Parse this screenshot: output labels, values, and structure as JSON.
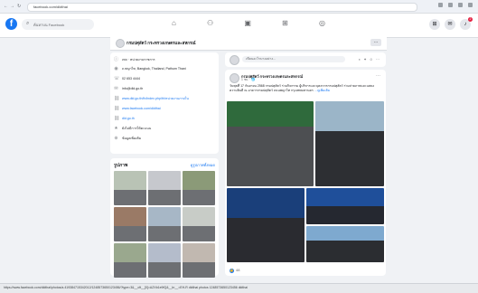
{
  "browser": {
    "url": "facebook.com/dldthai",
    "status_url": "https://www.facebook.com/dldthai/photos/a.419384715342012/1248573650123456/?type=3&__cft__[0]=AZXb1e9fQ&__tn__=EH-R dldthai photos 1248573650123456 dldthai"
  },
  "header": {
    "logo": "f",
    "search_placeholder": "ค้นหาบน Facebook",
    "notif_count": "2"
  },
  "page": {
    "name": "กรมปศุสัตว์ กระทรวงเกษตรและสหกรณ์",
    "more": "…"
  },
  "intro": {
    "items": [
      {
        "icon": "info-icon",
        "glyph": "ⓘ",
        "text": "เพจ · หน่วยงานราชการ"
      },
      {
        "icon": "location-icon",
        "glyph": "◉",
        "text": "ถ.พญาไท, Bangkok, Thailand, Pathum Thani"
      },
      {
        "icon": "phone-icon",
        "glyph": "☏",
        "text": "02 653 4444"
      },
      {
        "icon": "email-icon",
        "glyph": "✉",
        "text": "info@dld.go.th"
      },
      {
        "icon": "link-icon",
        "glyph": "⛓",
        "text": "www.dld.go.th/th/index.php/th/หน่วยงานภายใน",
        "link": true
      },
      {
        "icon": "link-icon",
        "glyph": "⛓",
        "text": "www.facebook.com/dldthai",
        "link": true
      },
      {
        "icon": "link-icon",
        "glyph": "⛓",
        "text": "dld.go.th",
        "link": true
      },
      {
        "icon": "rating-icon",
        "glyph": "★",
        "text": "ยังไม่มีการให้คะแนน"
      },
      {
        "icon": "globe-icon",
        "glyph": "⊕",
        "text": "ข้อมูลเพิ่มเติม"
      }
    ]
  },
  "photos": {
    "title": "รูปภาพ",
    "see_all": "ดูรูปภาพทั้งหมด",
    "colors": [
      "#b9c3b5",
      "#c6c8cd",
      "#8b9a78",
      "#9a7a66",
      "#a7b7c6",
      "#c8ccc7",
      "#9aa88e",
      "#b4bccb",
      "#c1b8b0"
    ]
  },
  "composer": {
    "placeholder": "เขียนอะไรบางอย่าง...",
    "tools": "◐ ✦ ☺ ⋯"
  },
  "post": {
    "author": "กรมปศุสัตว์ กระทรวงเกษตรและสหกรณ์",
    "time": "1 ชม. · 🌐",
    "text": "วันพุธที่ 17 กันยายน 2568 กรมปศุสัตว์ ร่วมกิจกรรม ผู้บริหารและบุคลากรกรมปศุสัตว์ ร่วมถ่ายภาพและแสดงความยินดี ณ อาคารกรมปศุสัตว์ ถนนพญาไท กรุงเทพมหานคร",
    "more": "…ดูเพิ่มเติม",
    "reactions": "48"
  },
  "colors": {
    "brand": "#1877f2",
    "bg": "#f0f2f5"
  }
}
